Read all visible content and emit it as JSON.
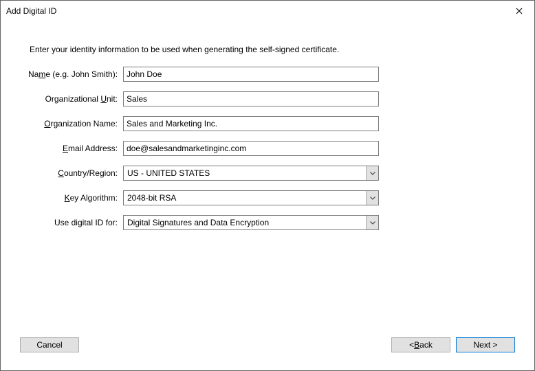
{
  "window": {
    "title": "Add Digital ID",
    "close_tooltip": "Close"
  },
  "intro_text": "Enter your identity information to be used when generating the self-signed certificate.",
  "fields": {
    "name": {
      "label_pre": "Na",
      "label_ak": "m",
      "label_post": "e (e.g. John Smith):",
      "value": "John Doe"
    },
    "org_unit": {
      "label_pre": "Organizational ",
      "label_ak": "U",
      "label_post": "nit:",
      "value": "Sales"
    },
    "org_name": {
      "label_pre": "",
      "label_ak": "O",
      "label_post": "rganization Name:",
      "value": "Sales and Marketing Inc."
    },
    "email": {
      "label_pre": "",
      "label_ak": "E",
      "label_post": "mail Address:",
      "value": "doe@salesandmarketinginc.com"
    },
    "country": {
      "label_pre": "",
      "label_ak": "C",
      "label_post": "ountry/Region:",
      "value": "US - UNITED STATES"
    },
    "key_alg": {
      "label_pre": "",
      "label_ak": "K",
      "label_post": "ey Algorithm:",
      "value": "2048-bit RSA"
    },
    "use_for": {
      "label_pre": "Use digital ID for:",
      "label_ak": "",
      "label_post": "",
      "value": "Digital Signatures and Data Encryption"
    }
  },
  "buttons": {
    "cancel": "Cancel",
    "back_pre": "< ",
    "back_ak": "B",
    "back_post": "ack",
    "next": "Next >"
  }
}
